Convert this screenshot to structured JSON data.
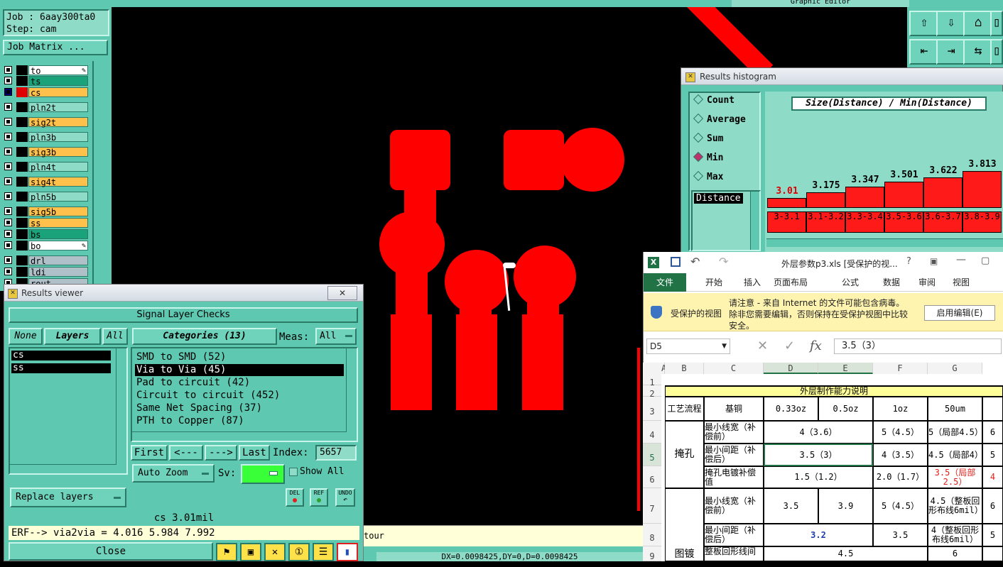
{
  "top_bar": {
    "title_partial": "Graphic Editor"
  },
  "left_panel": {
    "job_label": "Job : 6aay300ta0",
    "step_label": "Step: cam",
    "job_matrix_button": "Job Matrix ...",
    "layers": [
      {
        "name": "to",
        "color": "#ffffff"
      },
      {
        "name": "ts",
        "color": "#1aa37a"
      },
      {
        "name": "cs",
        "color": "#ffc04c"
      },
      {
        "name": "pln2t",
        "color": "#8edbc8"
      },
      {
        "name": "sig2t",
        "color": "#ffc04c"
      },
      {
        "name": "pln3b",
        "color": "#8edbc8"
      },
      {
        "name": "sig3b",
        "color": "#ffc04c"
      },
      {
        "name": "pln4t",
        "color": "#8edbc8"
      },
      {
        "name": "sig4t",
        "color": "#ffc04c"
      },
      {
        "name": "pln5b",
        "color": "#8edbc8"
      },
      {
        "name": "sig5b",
        "color": "#ffc04c"
      },
      {
        "name": "ss",
        "color": "#ffc04c"
      },
      {
        "name": "bs",
        "color": "#1aa37a"
      },
      {
        "name": "bo",
        "color": "#ffffff"
      },
      {
        "name": "drl",
        "color": "#b0c0c8"
      },
      {
        "name": "ldi",
        "color": "#b0c0c8"
      },
      {
        "name": "rout",
        "color": "#b0c0c8"
      }
    ]
  },
  "results_viewer": {
    "window_title": "Results viewer",
    "close_x": "✕",
    "header": "Signal Layer Checks",
    "none_btn": "None",
    "layers_btn": "Layers",
    "all_btn": "All",
    "categories_btn": "Categories (13)",
    "meas_label": "Meas:",
    "meas_value": "All",
    "layer_list": [
      "cs",
      "ss"
    ],
    "categories": [
      "SMD to SMD (52)",
      "Via to Via (45)",
      "Pad to circuit (42)",
      "Circuit to circuit (452)",
      "Same Net Spacing (37)",
      "PTH to Copper (87)"
    ],
    "selected_category": 1,
    "first_btn": "First",
    "prev_btn": "<---",
    "next_btn": "--->",
    "last_btn": "Last",
    "index_label": "Index:",
    "index_value": "5657",
    "auto_zoom": "Auto Zoom",
    "sv_label": "Sv:",
    "show_all": "Show All",
    "replace_layers": "Replace layers",
    "del_btn": "DEL",
    "ref_btn": "REF",
    "undo_btn": "UNDO",
    "status_value": "cs 3.01mil",
    "erf_line": "ERF--> via2via = 4.016 5.984 7.992",
    "close_btn": "Close",
    "tool_icons": [
      "measure-icon",
      "zoom-icon",
      "ref-off-icon",
      "numbers-icon",
      "report-icon",
      "histogram-icon"
    ]
  },
  "status_bar": {
    "tour_text": "tour",
    "coords": "DX=0.0098425,DY=0,D=0.0098425"
  },
  "results_histogram": {
    "window_title": "Results histogram",
    "chart_title": "Size(Distance) / Min(Distance)",
    "options": [
      "Count",
      "Average",
      "Sum",
      "Min",
      "Max"
    ],
    "selected_option": "Min",
    "distance_item": "Distance",
    "bars": [
      {
        "label": "3.01",
        "range": "3-3.1",
        "value": 3.01,
        "highlight": true
      },
      {
        "label": "3.175",
        "range": "3.1-3.2",
        "value": 3.175
      },
      {
        "label": "3.347",
        "range": "3.3-3.4",
        "value": 3.347
      },
      {
        "label": "3.501",
        "range": "3.5-3.6",
        "value": 3.501
      },
      {
        "label": "3.622",
        "range": "3.6-3.7",
        "value": 3.622
      },
      {
        "label": "3.813",
        "range": "3.8-3.9",
        "value": 3.813
      }
    ]
  },
  "excel": {
    "tab_title": "外层参数p3.xls [受保护的视...",
    "ribbon_tabs": [
      "文件",
      "开始",
      "插入",
      "页面布局",
      "公式",
      "数据",
      "审阅",
      "视图"
    ],
    "protected_label": "受保护的视图",
    "protected_msg1": "请注意 - 来自 Internet 的文件可能包含病毒。",
    "protected_msg2": "除非您需要编辑，否则保持在受保护视图中比较",
    "protected_msg3": "安全。",
    "enable_btn": "启用编辑(E)",
    "name_box": "D5",
    "formula_value": "3.5（3）",
    "fx_label": "fx",
    "col_headers": [
      "A",
      "B",
      "C",
      "D",
      "E",
      "F",
      "G"
    ],
    "row_numbers": [
      "1",
      "2",
      "3",
      "4",
      "5",
      "6",
      "7",
      "8",
      "9"
    ],
    "sheet_title": "外层制作能力说明",
    "hdr_process": "工艺流程",
    "hdr_base": "基铜",
    "hdr_033": "0.33oz",
    "hdr_05": "0.5oz",
    "hdr_1": "1oz",
    "hdr_50": "50um",
    "grp_tenting": "掩孔",
    "grp_plating": "图镀",
    "r4_label": "最小线宽（补偿前）",
    "r4_d": "4（3.6）",
    "r4_f": "5（4.5）",
    "r4_g": "5（局部4.5）",
    "r4_h": "6",
    "r5_label": "最小间距（补偿后）",
    "r5_d": "3.5（3）",
    "r5_f": "4（3.5）",
    "r5_g": "4.5（局部4）",
    "r5_h": "5",
    "r6_label": "掩孔电镀补偿值",
    "r6_d": "1.5（1.2）",
    "r6_f": "2.0（1.7）",
    "r6_g": "3.5（局部2.5）",
    "r6_h": "4",
    "r7_label": "最小线宽（补偿前）",
    "r7_d": "3.5",
    "r7_e": "3.9",
    "r7_f": "5（4.5）",
    "r7_g": "4.5（整板回形布线6mil）",
    "r7_h": "6",
    "r8_label": "最小间距（补偿后）",
    "r8_d": "3.2",
    "r8_f": "3.5",
    "r8_g": "4（整板回形布线6mil）",
    "r8_h": "5",
    "r9_label": "整板回形线间",
    "r9_d": "4.5",
    "r9_g": "6",
    "red_text": "#e0201a",
    "blue_text": "#1f3ea8"
  }
}
